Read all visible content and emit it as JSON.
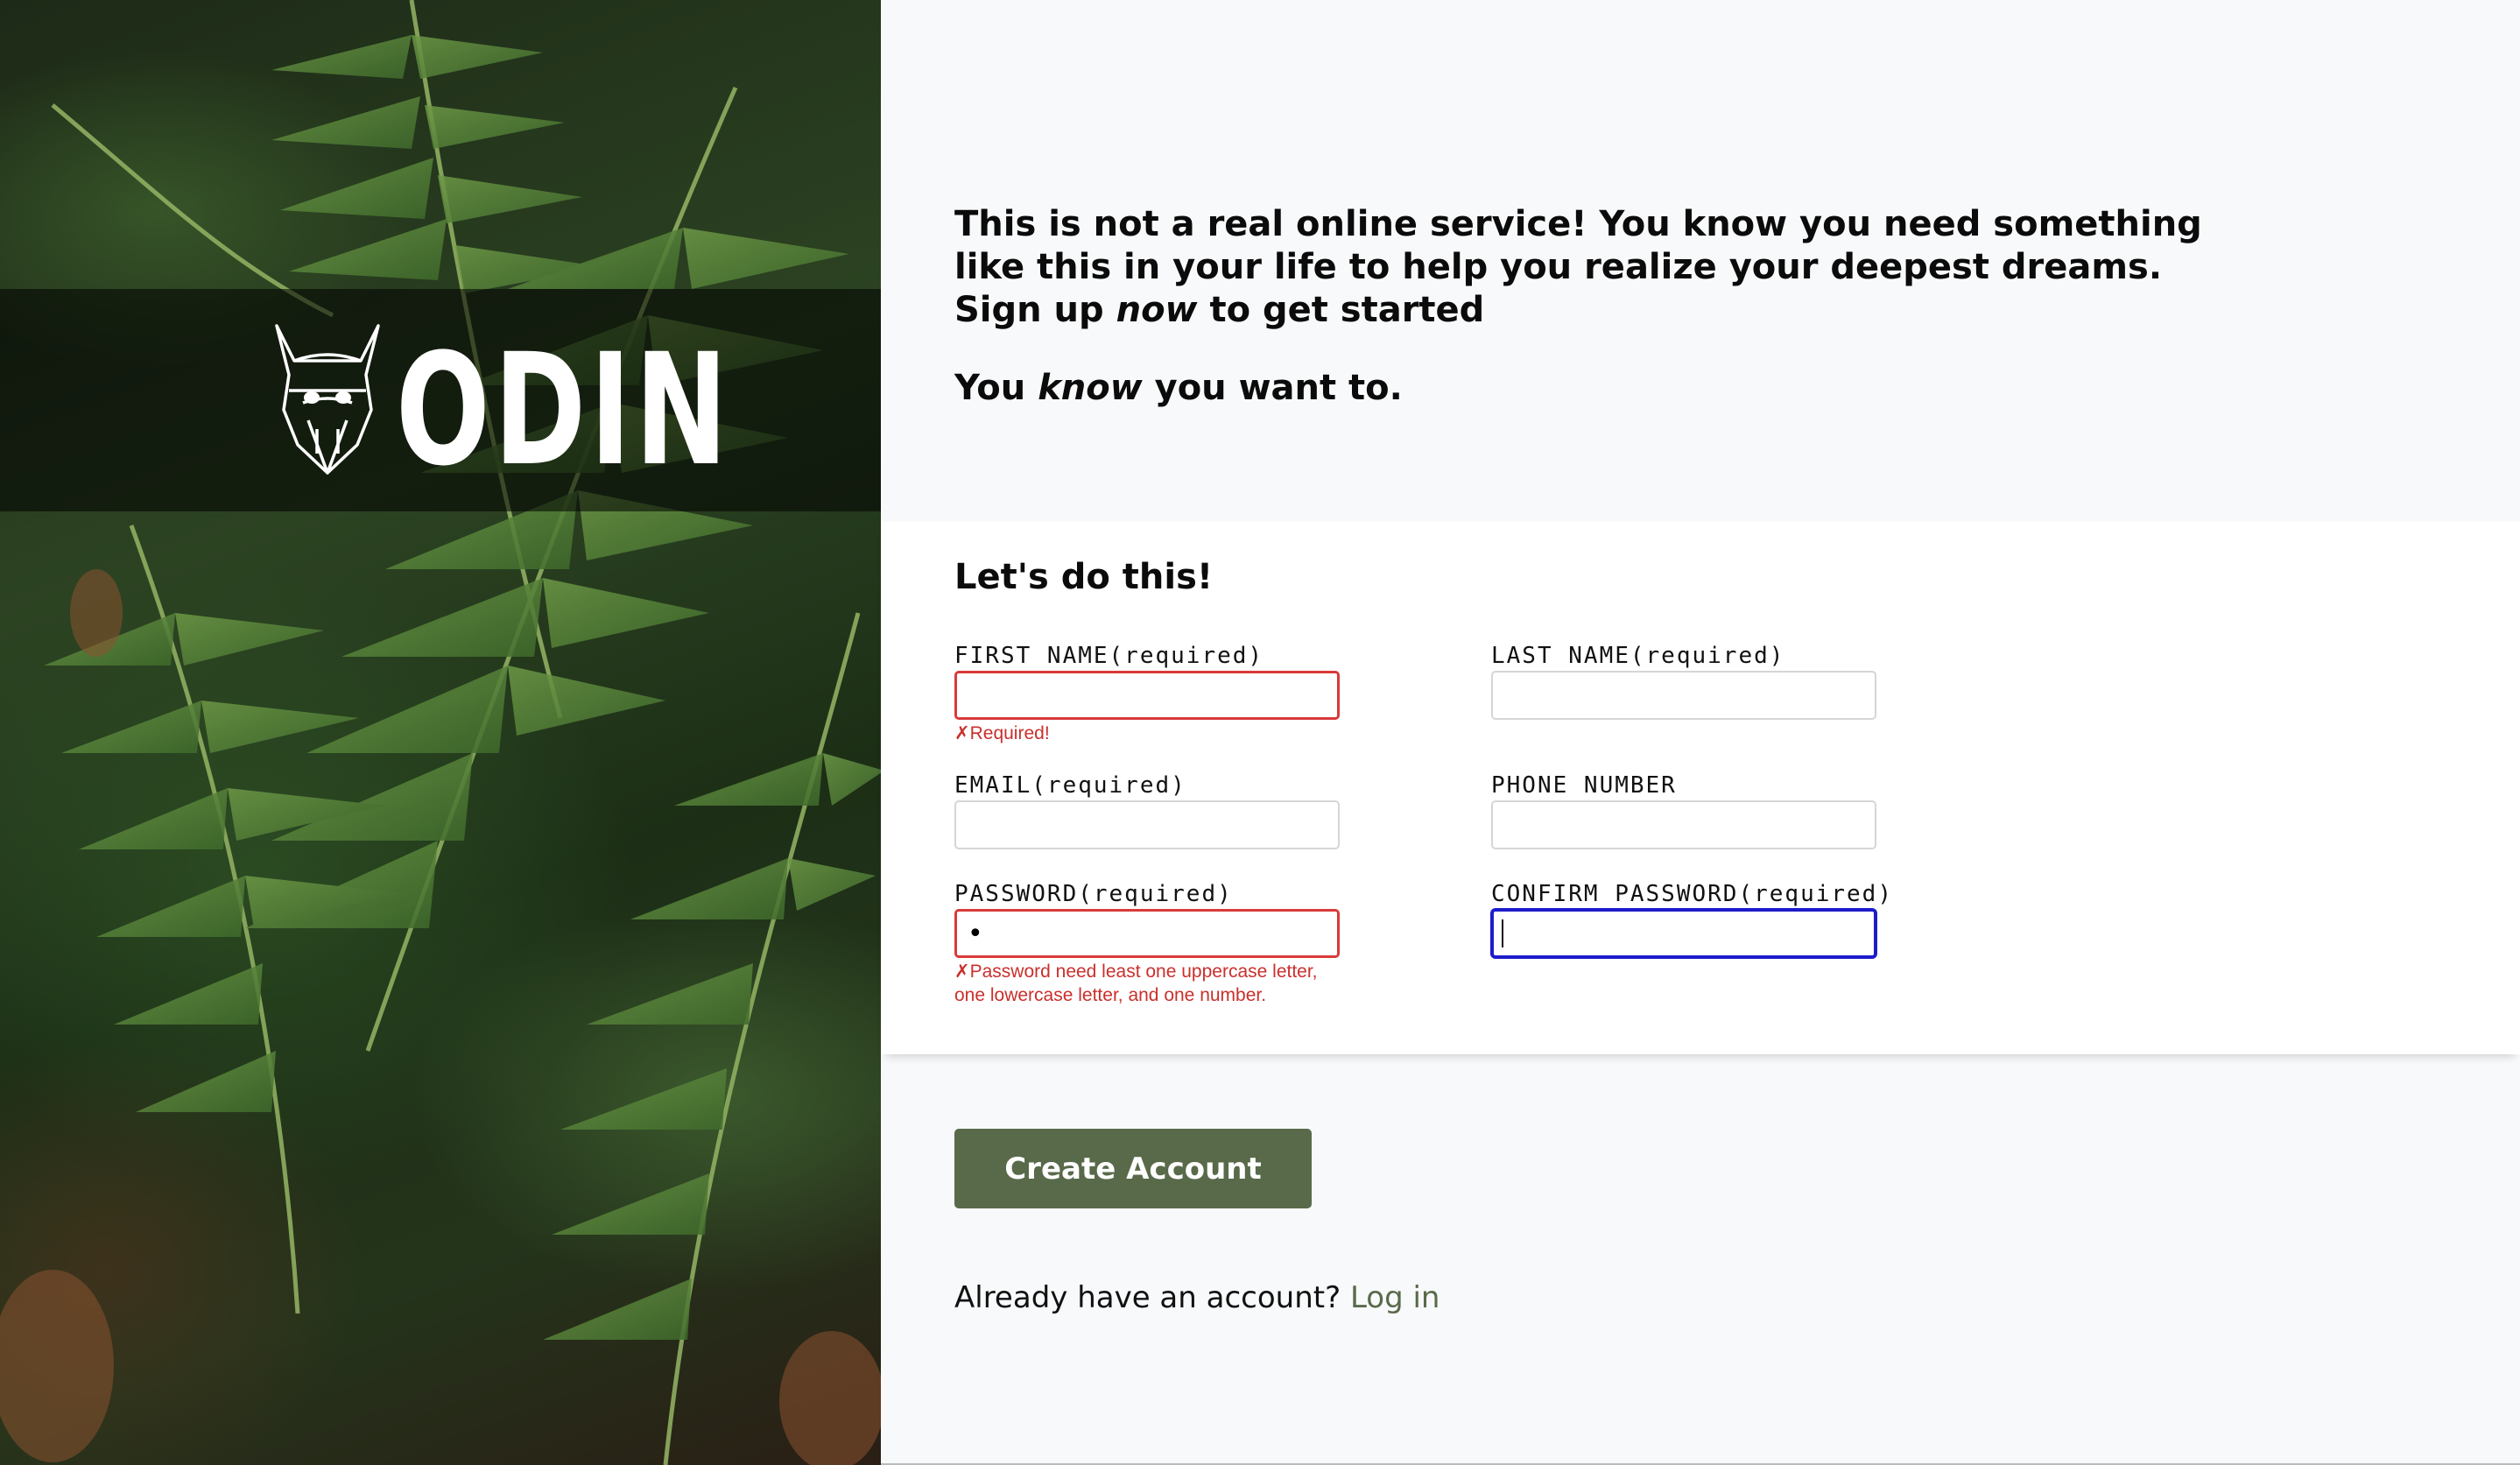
{
  "hero": {
    "logo_text": "ODIN",
    "logo_icon": "viking-helmet-icon"
  },
  "intro": {
    "line1": "This is not a real online service! You know you need something like this in your life to help you realize your deepest dreams.",
    "line2_pre": "Sign up ",
    "line2_em": "now",
    "line2_post": " to get started",
    "line3_pre": "You ",
    "line3_em": "know",
    "line3_post": " you want to."
  },
  "form": {
    "title": "Let's do this!",
    "first_name": {
      "label": "FIRST NAME(required)",
      "value": "",
      "error": "✗Required!"
    },
    "last_name": {
      "label": "LAST NAME(required)",
      "value": ""
    },
    "email": {
      "label": "EMAIL(required)",
      "value": ""
    },
    "phone": {
      "label": "PHONE NUMBER",
      "value": ""
    },
    "password": {
      "label": "PASSWORD(required)",
      "value": "•",
      "error_line1": "✗Password need least one uppercase letter,",
      "error_line2": "one lowercase letter, and one number."
    },
    "confirm_password": {
      "label": "CONFIRM PASSWORD(required)",
      "value": ""
    }
  },
  "actions": {
    "create_label": "Create Account",
    "login_prompt": "Already have an account?",
    "login_link": "Log in"
  },
  "colors": {
    "accent": "#596a4a",
    "error": "#d93a3a",
    "focus": "#1c1ccc"
  }
}
